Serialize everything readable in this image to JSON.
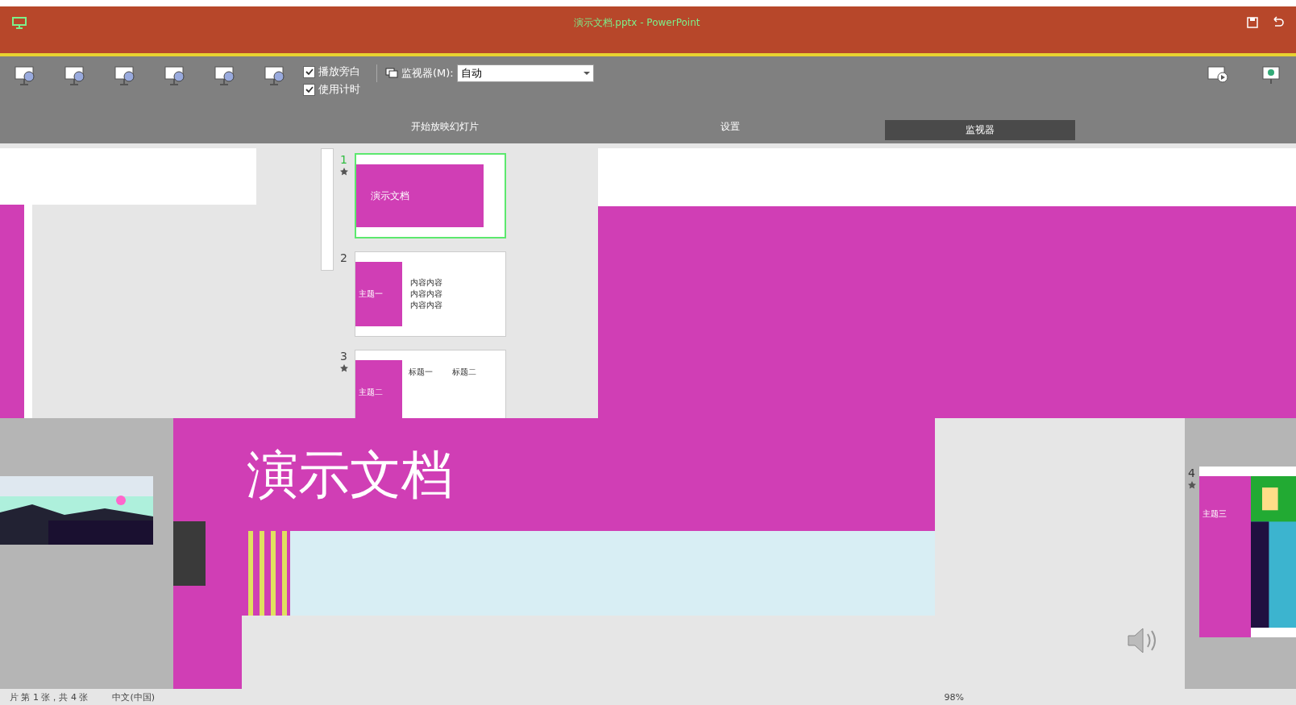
{
  "window": {
    "title": "演示文档.pptx - PowerPoint"
  },
  "ribbon": {
    "checkboxes": [
      {
        "label": "播放旁白",
        "checked": true
      },
      {
        "label": "使用计时",
        "checked": true
      }
    ],
    "monitor": {
      "label": "监视器(M):",
      "value": "自动"
    },
    "groups": [
      "开始放映幻灯片",
      "设置",
      "监视器"
    ]
  },
  "slides": [
    {
      "number": "1",
      "selected": true,
      "animated": true,
      "kind": "title",
      "title": "演示文档"
    },
    {
      "number": "2",
      "selected": false,
      "animated": false,
      "kind": "content",
      "title": "主题一",
      "bullets": [
        "内容内容",
        "内容内容",
        "内容内容"
      ]
    },
    {
      "number": "3",
      "selected": false,
      "animated": true,
      "kind": "columns",
      "title": "主题二",
      "headings": [
        "标题一",
        "标题二"
      ]
    }
  ],
  "slide_4": {
    "number": "4",
    "animated": true,
    "title": "主题三"
  },
  "main_slide": {
    "title": "演示文档"
  },
  "status_bar": {
    "slide_info": "片 第 1 张，共 4 张",
    "language": "中文(中国)",
    "zoom": "98%"
  }
}
